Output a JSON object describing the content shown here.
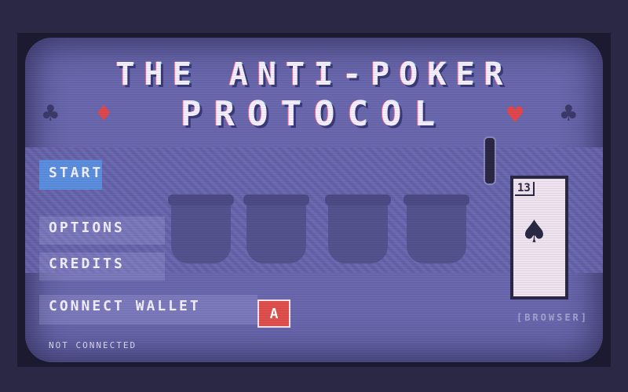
{
  "title": {
    "line1": "THE ANTI-POKER",
    "line2": "PROTOCOL"
  },
  "suits": {
    "club": "♣",
    "diamond": "♦",
    "heart": "♥",
    "spade": "♠"
  },
  "menu": {
    "start": "START",
    "options": "OPTIONS",
    "credits": "CREDITS",
    "connect_wallet": "CONNECT WALLET",
    "wallet_icon": "A"
  },
  "status": {
    "connection": "NOT CONNECTED"
  },
  "card": {
    "number": "13"
  },
  "platform_label": "[BROWSER]",
  "colors": {
    "screen": "#6a68ae",
    "accent_red": "#e0484e",
    "selected": "#5c8fe0",
    "ink": "#2a2844"
  }
}
